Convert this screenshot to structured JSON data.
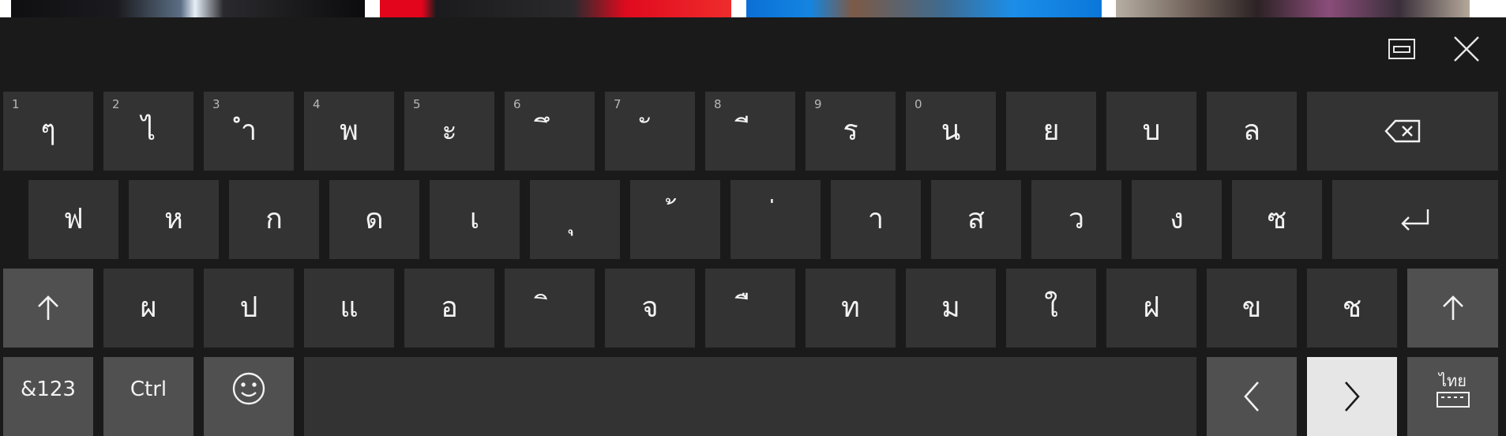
{
  "thumbnails": [
    "laptop-photo-1",
    "laptop-photo-2",
    "laptop-photo-3",
    "laptop-photo-4"
  ],
  "window_controls": {
    "dock_icon": "dock-keyboard-icon",
    "close_icon": "close-icon"
  },
  "rows": {
    "row1": [
      {
        "hint": "1",
        "char": "ๆ"
      },
      {
        "hint": "2",
        "char": "ไ"
      },
      {
        "hint": "3",
        "char": "ำ"
      },
      {
        "hint": "4",
        "char": "พ"
      },
      {
        "hint": "5",
        "char": "ะ"
      },
      {
        "hint": "6",
        "char": "ึ"
      },
      {
        "hint": "7",
        "char": "ั"
      },
      {
        "hint": "8",
        "char": "ี"
      },
      {
        "hint": "9",
        "char": "ร"
      },
      {
        "hint": "0",
        "char": "น"
      },
      {
        "hint": "",
        "char": "ย"
      },
      {
        "hint": "",
        "char": "บ"
      },
      {
        "hint": "",
        "char": "ล"
      }
    ],
    "row2": [
      "ฟ",
      "ห",
      "ก",
      "ด",
      "เ",
      "ุ",
      "้",
      "่",
      "า",
      "ส",
      "ว",
      "ง",
      "ซ"
    ],
    "row3": [
      "ผ",
      "ป",
      "แ",
      "อ",
      "ิ",
      "จ",
      "ื",
      "ท",
      "ม",
      "ใ",
      "ฝ",
      "ข",
      "ช"
    ]
  },
  "special": {
    "numbers_label": "&123",
    "ctrl_label": "Ctrl",
    "emoji_icon": "emoji-icon",
    "backspace_icon": "backspace-icon",
    "enter_icon": "enter-icon",
    "shift_icon": "shift-up-arrow-icon",
    "left_icon": "chevron-left-icon",
    "right_icon": "chevron-right-icon",
    "language_label": "ไทย",
    "language_icon": "keyboard-icon"
  },
  "colors": {
    "background": "#1a1a1a",
    "key": "#333333",
    "key_modifier": "#505050",
    "key_highlight": "#e6e6e6",
    "text": "#f2f2f2"
  }
}
